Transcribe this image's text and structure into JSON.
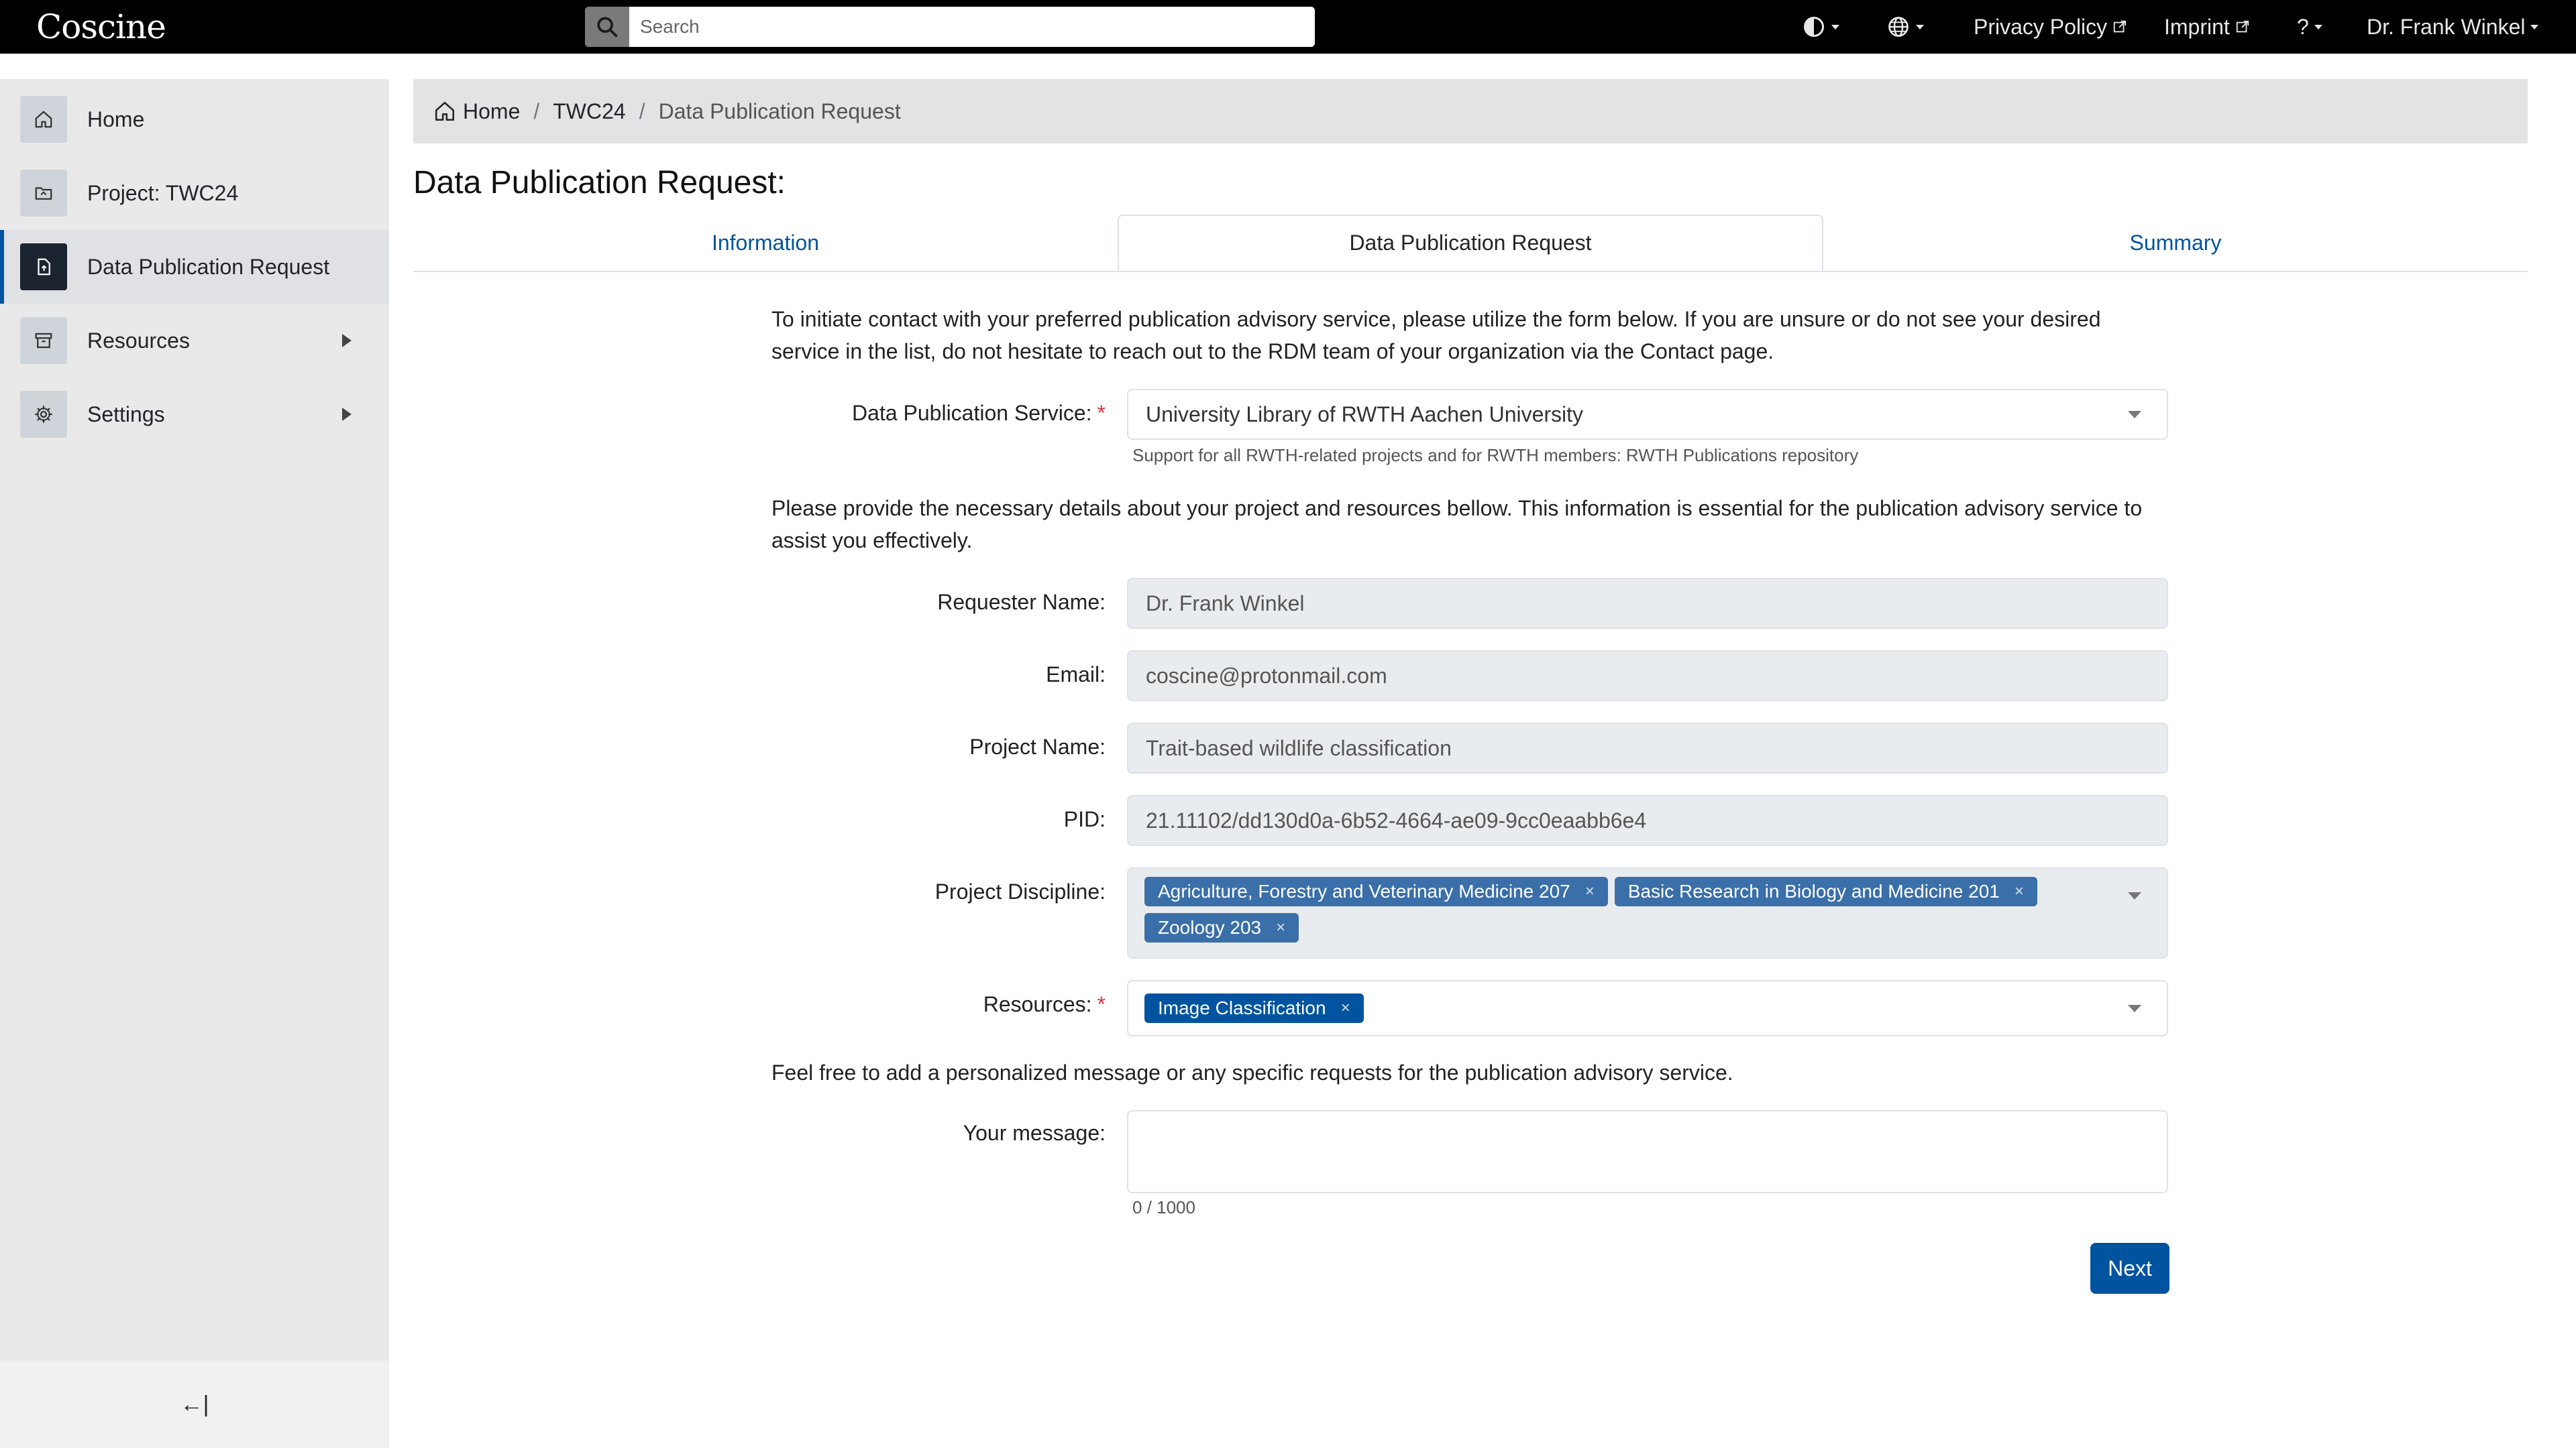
{
  "header": {
    "logo_text": "Coscine",
    "search_placeholder": "Search",
    "privacy_label": "Privacy Policy",
    "imprint_label": "Imprint",
    "help_label": "?",
    "user_name": "Dr. Frank Winkel"
  },
  "sidebar": {
    "items": [
      {
        "label": "Home",
        "icon": "home-icon"
      },
      {
        "label": "Project: TWC24",
        "icon": "folder-icon"
      },
      {
        "label": "Data Publication Request",
        "icon": "file-upload-icon"
      },
      {
        "label": "Resources",
        "icon": "archive-icon"
      },
      {
        "label": "Settings",
        "icon": "gear-icon"
      }
    ],
    "collapse_label": "←|"
  },
  "breadcrumb": {
    "home": "Home",
    "project": "TWC24",
    "current": "Data Publication Request"
  },
  "page": {
    "title": "Data Publication Request:",
    "tabs": [
      "Information",
      "Data Publication Request",
      "Summary"
    ],
    "intro": "To initiate contact with your preferred publication advisory service, please utilize the form below. If you are unsure or do not see your desired service in the list, do not hesitate to reach out to the RDM team of your organization via the Contact page.",
    "details_intro": "Please provide the necessary details about your project and resources bellow. This information is essential for the publication advisory service to assist you effectively.",
    "message_intro": "Feel free to add a personalized message or any specific requests for the publication advisory service."
  },
  "form": {
    "service_label": "Data Publication Service:",
    "service_value": "University Library of RWTH Aachen University",
    "service_help": "Support for all RWTH-related projects and for RWTH members: RWTH Publications repository",
    "requester_label": "Requester Name:",
    "requester_value": "Dr. Frank Winkel",
    "email_label": "Email:",
    "email_value": "coscine@protonmail.com",
    "project_label": "Project Name:",
    "project_value": "Trait-based wildlife classification",
    "pid_label": "PID:",
    "pid_value": "21.11102/dd130d0a-6b52-4664-ae09-9cc0eaabb6e4",
    "discipline_label": "Project Discipline:",
    "disciplines": [
      "Agriculture, Forestry and Veterinary Medicine 207",
      "Basic Research in Biology and Medicine 201",
      "Zoology 203"
    ],
    "resources_label": "Resources:",
    "resources": [
      "Image Classification"
    ],
    "message_label": "Your message:",
    "message_value": "",
    "message_counter": "0 / 1000",
    "required_mark": "*",
    "chip_remove": "×",
    "next_label": "Next"
  },
  "colors": {
    "brand": "#00549f",
    "topbar": "#000000",
    "sidebar_bg": "#e9e9e9",
    "readonly_bg": "#e9ecef",
    "required": "#dc3545"
  }
}
